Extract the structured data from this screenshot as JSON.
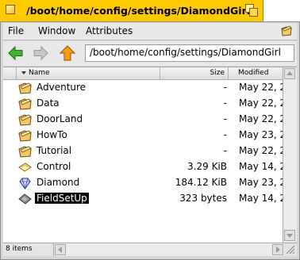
{
  "window": {
    "title": "/boot/home/config/settings/DiamondGirl"
  },
  "menu": [
    "File",
    "Window",
    "Attributes"
  ],
  "toolbar": {
    "path": "/boot/home/config/settings/DiamondGirl"
  },
  "columns": {
    "name": "Name",
    "size": "Size",
    "modified": "Modified"
  },
  "files": [
    {
      "name": "Adventure",
      "size": "-",
      "modified": "May 22, 20",
      "icon": "folder-icon"
    },
    {
      "name": "Data",
      "size": "-",
      "modified": "May 22, 20",
      "icon": "folder-icon"
    },
    {
      "name": "DoorLand",
      "size": "-",
      "modified": "May 22, 20",
      "icon": "folder-icon"
    },
    {
      "name": "HowTo",
      "size": "-",
      "modified": "May 23, 20",
      "icon": "folder-icon"
    },
    {
      "name": "Tutorial",
      "size": "-",
      "modified": "May 22, 20",
      "icon": "folder-icon"
    },
    {
      "name": "Control",
      "size": "3.29 KiB",
      "modified": "May 14, 20",
      "icon": "settings-file-icon"
    },
    {
      "name": "Diamond",
      "size": "184.12 KiB",
      "modified": "May 23, 20",
      "icon": "diamond-file-icon"
    },
    {
      "name": "FieldSetUp",
      "size": "323 bytes",
      "modified": "May 14, 20",
      "icon": "generic-file-icon",
      "selected": true
    }
  ],
  "status": {
    "count": "8 items"
  },
  "colors": {
    "tab": "#ffcb00",
    "folder": "#f5c869",
    "selection": "#000000"
  }
}
